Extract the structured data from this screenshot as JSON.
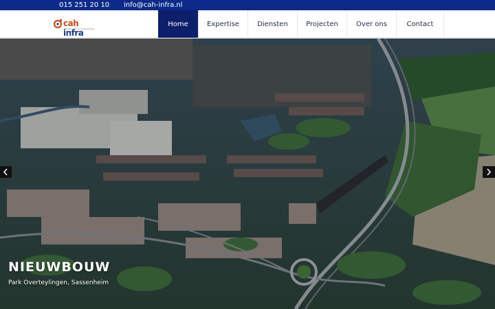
{
  "topbar": {
    "phone": "015 251 20 10",
    "email": "info@cah-infra.nl"
  },
  "logo": {
    "brand_prefix": "cah",
    "brand_suffix": " infra",
    "tagline": "infratechniek en bodemadvies"
  },
  "nav": {
    "items": [
      {
        "label": "Home",
        "active": true
      },
      {
        "label": "Expertise",
        "active": false
      },
      {
        "label": "Diensten",
        "active": false
      },
      {
        "label": "Projecten",
        "active": false
      },
      {
        "label": "Over ons",
        "active": false
      },
      {
        "label": "Contact",
        "active": false
      }
    ]
  },
  "hero": {
    "title": "NIEUWBOUW",
    "subtitle": "Park Overteylingen, Sassenheim",
    "prev_icon": "chevron-left-icon",
    "next_icon": "chevron-right-icon"
  },
  "colors": {
    "topbar": "#0d2a8a",
    "nav_active": "#0d1f6b",
    "logo_orange": "#d24a1c",
    "logo_blue": "#1f3a8f"
  }
}
